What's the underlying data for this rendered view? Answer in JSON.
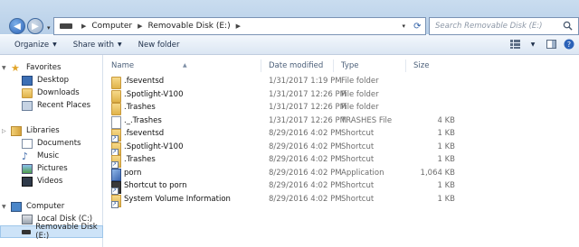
{
  "address": {
    "path": [
      "Computer",
      "Removable Disk (E:)"
    ],
    "search_placeholder": "Search Removable Disk (E:)"
  },
  "toolbar": {
    "organize": "Organize",
    "share_with": "Share with",
    "new_folder": "New folder"
  },
  "navpane": {
    "favorites": "Favorites",
    "desktop": "Desktop",
    "downloads": "Downloads",
    "recent_places": "Recent Places",
    "libraries": "Libraries",
    "documents": "Documents",
    "music": "Music",
    "pictures": "Pictures",
    "videos": "Videos",
    "computer": "Computer",
    "local_disk": "Local Disk (C:)",
    "removable_disk": "Removable Disk (E:)"
  },
  "columns": {
    "name": "Name",
    "date": "Date modified",
    "type": "Type",
    "size": "Size"
  },
  "files": [
    {
      "name": ".fseventsd",
      "date": "1/31/2017 1:19 PM",
      "type": "File folder",
      "size": "",
      "icon": "folder-icon"
    },
    {
      "name": ".Spotlight-V100",
      "date": "1/31/2017 12:26 PM",
      "type": "File folder",
      "size": "",
      "icon": "folder-icon"
    },
    {
      "name": ".Trashes",
      "date": "1/31/2017 12:26 PM",
      "type": "File folder",
      "size": "",
      "icon": "folder-icon"
    },
    {
      "name": "._.Trashes",
      "date": "1/31/2017 12:26 PM",
      "type": "TRASHES File",
      "size": "4 KB",
      "icon": "file-icon"
    },
    {
      "name": ".fseventsd",
      "date": "8/29/2016 4:02 PM",
      "type": "Shortcut",
      "size": "1 KB",
      "icon": "shortcut-icon"
    },
    {
      "name": ".Spotlight-V100",
      "date": "8/29/2016 4:02 PM",
      "type": "Shortcut",
      "size": "1 KB",
      "icon": "shortcut-icon"
    },
    {
      "name": ".Trashes",
      "date": "8/29/2016 4:02 PM",
      "type": "Shortcut",
      "size": "1 KB",
      "icon": "shortcut-icon"
    },
    {
      "name": "porn",
      "date": "8/29/2016 4:02 PM",
      "type": "Application",
      "size": "1,064 KB",
      "icon": "application-icon"
    },
    {
      "name": "Shortcut to porn",
      "date": "8/29/2016 4:02 PM",
      "type": "Shortcut",
      "size": "1 KB",
      "icon": "shortcut-app-icon"
    },
    {
      "name": "System Volume Information",
      "date": "8/29/2016 4:02 PM",
      "type": "Shortcut",
      "size": "1 KB",
      "icon": "shortcut-icon"
    }
  ]
}
